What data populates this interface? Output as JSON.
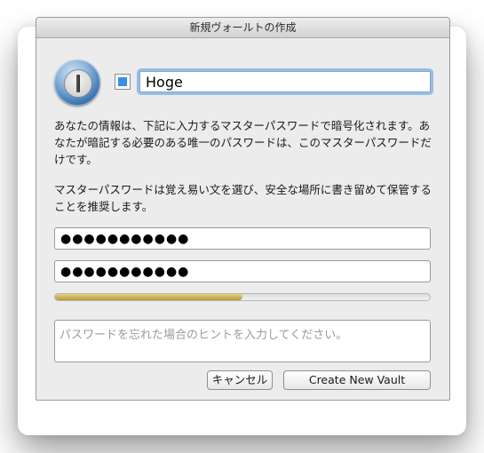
{
  "window": {
    "title": "新規ヴォールトの作成"
  },
  "vault": {
    "color": "#3a8ee6",
    "name": "Hoge"
  },
  "description": {
    "paragraph1": "あなたの情報は、下記に入力するマスターパスワードで暗号化されます。あなたが暗記する必要のある唯一のパスワードは、このマスターパスワードだけです。",
    "paragraph2": "マスターパスワードは覚え易い文を選び、安全な場所に書き留めて保管することを推奨します。"
  },
  "password": {
    "value": "●●●●●●●●●●●",
    "confirm_value": "●●●●●●●●●●●",
    "strength_fraction": 0.5,
    "strength_color": "#c9ab52"
  },
  "hint": {
    "placeholder": "パスワードを忘れた場合のヒントを入力してください。"
  },
  "buttons": {
    "cancel_label": "キャンセル",
    "create_label": "Create New Vault"
  }
}
